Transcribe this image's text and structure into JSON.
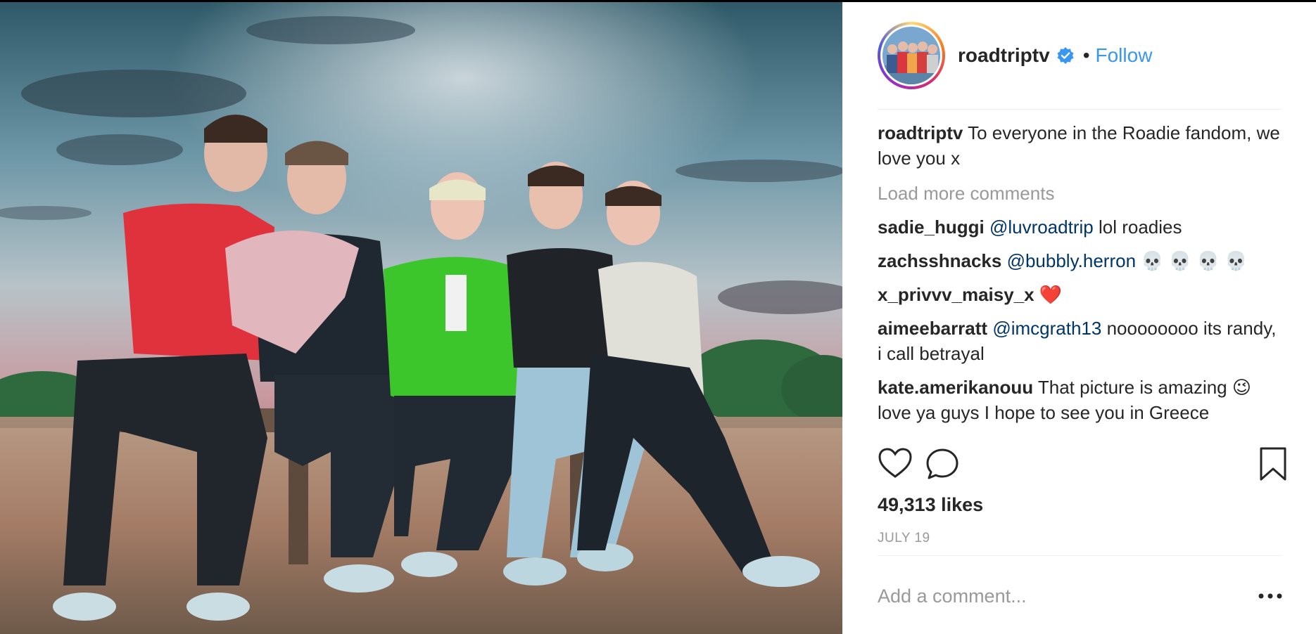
{
  "post": {
    "photo_alt": "",
    "username": "roadtriptv",
    "verified": true,
    "separator": "•",
    "follow_label": "Follow",
    "caption_user": "roadtriptv",
    "caption_text": "To everyone in the Roadie fandom, we love you x",
    "load_more": "Load more comments",
    "comments": [
      {
        "user": "sadie_huggi",
        "mention": "@luvroadtrip",
        "text": "lol roadies"
      },
      {
        "user": "zachsshnacks",
        "mention": "@bubbly.herron",
        "text": "💀 💀 💀 💀"
      },
      {
        "user": "x_privvv_maisy_x",
        "mention": "",
        "text": "❤️"
      },
      {
        "user": "aimeebarratt",
        "mention": "@imcgrath13",
        "text": "noooooooo its randy, i call betrayal"
      },
      {
        "user": "kate.amerikanouu",
        "mention": "",
        "text": "That picture is amazing 😉 love ya guys I hope to see you in Greece"
      }
    ],
    "likes": "49,313 likes",
    "date": "JULY 19",
    "add_comment_placeholder": "Add a comment...",
    "icons": {
      "like": "heart-icon",
      "comment": "comment-icon",
      "save": "bookmark-icon",
      "more": "more-options-icon",
      "verified": "verified-badge-icon"
    },
    "colors": {
      "link": "#3897f0",
      "mention": "#003569",
      "muted": "#999999",
      "text": "#262626"
    }
  }
}
